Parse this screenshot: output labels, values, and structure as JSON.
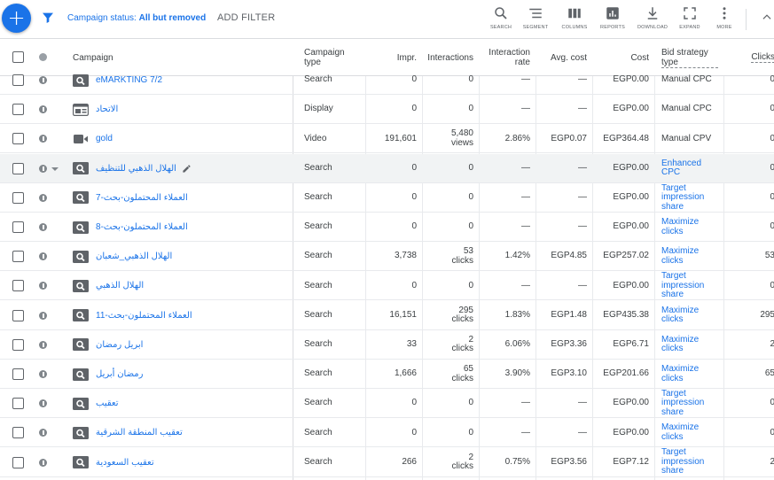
{
  "toolbar": {
    "new_button_label": "+",
    "filter_prefix": "Campaign status:",
    "filter_value": "All but removed",
    "add_filter_label": "ADD FILTER",
    "tools": [
      {
        "label": "SEARCH",
        "icon": "search-icon"
      },
      {
        "label": "SEGMENT",
        "icon": "segment-icon"
      },
      {
        "label": "COLUMNS",
        "icon": "columns-icon"
      },
      {
        "label": "REPORTS",
        "icon": "reports-icon"
      },
      {
        "label": "DOWNLOAD",
        "icon": "download-icon"
      },
      {
        "label": "EXPAND",
        "icon": "expand-icon"
      },
      {
        "label": "MORE",
        "icon": "more-vert-icon"
      }
    ],
    "collapse_icon": "chevron-up-icon"
  },
  "colors": {
    "accent": "#1a73e8",
    "text": "#3c4043",
    "border": "#dadce0"
  },
  "table": {
    "headers": {
      "campaign": "Campaign",
      "campaign_type": "Campaign type",
      "impr": "Impr.",
      "interactions": "Interactions",
      "interaction_rate": "Interaction rate",
      "avg_cost": "Avg. cost",
      "cost": "Cost",
      "bid_strategy": "Bid strategy type",
      "clicks": "Clicks"
    },
    "rows": [
      {
        "name": "eMARKTING 7/2",
        "type_icon": "search-campaign-icon",
        "type": "Search",
        "impr": "0",
        "interactions": "0",
        "interactions_unit": "",
        "rate": "—",
        "avg_cost": "—",
        "cost": "EGP0.00",
        "bid": "Manual CPC",
        "bid_link": false,
        "clicks": "0"
      },
      {
        "name": "الاتحاد",
        "type_icon": "display-campaign-icon",
        "type": "Display",
        "impr": "0",
        "interactions": "0",
        "interactions_unit": "",
        "rate": "—",
        "avg_cost": "—",
        "cost": "EGP0.00",
        "bid": "Manual CPC",
        "bid_link": false,
        "clicks": "0"
      },
      {
        "name": "gold",
        "type_icon": "video-campaign-icon",
        "type": "Video",
        "impr": "191,601",
        "interactions": "5,480",
        "interactions_unit": "views",
        "rate": "2.86%",
        "avg_cost": "EGP0.07",
        "cost": "EGP364.48",
        "bid": "Manual CPV",
        "bid_link": false,
        "clicks": "0"
      },
      {
        "name": "الهلال الذهبي للتنظيف",
        "type_icon": "search-campaign-icon",
        "type": "Search",
        "impr": "0",
        "interactions": "0",
        "interactions_unit": "",
        "rate": "—",
        "avg_cost": "—",
        "cost": "EGP0.00",
        "bid": "Enhanced CPC",
        "bid_link": true,
        "clicks": "0",
        "highlight": true
      },
      {
        "name": "العملاء المحتملون-بحث-7",
        "type_icon": "search-campaign-icon",
        "type": "Search",
        "impr": "0",
        "interactions": "0",
        "interactions_unit": "",
        "rate": "—",
        "avg_cost": "—",
        "cost": "EGP0.00",
        "bid": "Target impression share",
        "bid_link": true,
        "clicks": "0"
      },
      {
        "name": "العملاء المحتملون-بحث-8",
        "type_icon": "search-campaign-icon",
        "type": "Search",
        "impr": "0",
        "interactions": "0",
        "interactions_unit": "",
        "rate": "—",
        "avg_cost": "—",
        "cost": "EGP0.00",
        "bid": "Maximize clicks",
        "bid_link": true,
        "clicks": "0"
      },
      {
        "name": "الهلال الذهبي_شعبان",
        "type_icon": "search-campaign-icon",
        "type": "Search",
        "impr": "3,738",
        "interactions": "53",
        "interactions_unit": "clicks",
        "rate": "1.42%",
        "avg_cost": "EGP4.85",
        "cost": "EGP257.02",
        "bid": "Maximize clicks",
        "bid_link": true,
        "clicks": "53"
      },
      {
        "name": "الهلال الذهبي",
        "type_icon": "search-campaign-icon",
        "type": "Search",
        "impr": "0",
        "interactions": "0",
        "interactions_unit": "",
        "rate": "—",
        "avg_cost": "—",
        "cost": "EGP0.00",
        "bid": "Target impression share",
        "bid_link": true,
        "clicks": "0"
      },
      {
        "name": "العملاء المحتملون-بحث-11",
        "type_icon": "search-campaign-icon",
        "type": "Search",
        "impr": "16,151",
        "interactions": "295",
        "interactions_unit": "clicks",
        "rate": "1.83%",
        "avg_cost": "EGP1.48",
        "cost": "EGP435.38",
        "bid": "Maximize clicks",
        "bid_link": true,
        "clicks": "295"
      },
      {
        "name": "ابريل رمضان",
        "type_icon": "search-campaign-icon",
        "type": "Search",
        "impr": "33",
        "interactions": "2",
        "interactions_unit": "clicks",
        "rate": "6.06%",
        "avg_cost": "EGP3.36",
        "cost": "EGP6.71",
        "bid": "Maximize clicks",
        "bid_link": true,
        "clicks": "2"
      },
      {
        "name": "رمضان أبريل",
        "type_icon": "search-campaign-icon",
        "type": "Search",
        "impr": "1,666",
        "interactions": "65",
        "interactions_unit": "clicks",
        "rate": "3.90%",
        "avg_cost": "EGP3.10",
        "cost": "EGP201.66",
        "bid": "Maximize clicks",
        "bid_link": true,
        "clicks": "65"
      },
      {
        "name": "تعقيب",
        "type_icon": "search-campaign-icon",
        "type": "Search",
        "impr": "0",
        "interactions": "0",
        "interactions_unit": "",
        "rate": "—",
        "avg_cost": "—",
        "cost": "EGP0.00",
        "bid": "Target impression share",
        "bid_link": true,
        "clicks": "0"
      },
      {
        "name": "تعقيب المنطقة الشرقية",
        "type_icon": "search-campaign-icon",
        "type": "Search",
        "impr": "0",
        "interactions": "0",
        "interactions_unit": "",
        "rate": "—",
        "avg_cost": "—",
        "cost": "EGP0.00",
        "bid": "Maximize clicks",
        "bid_link": true,
        "clicks": "0"
      },
      {
        "name": "تعقيب السعودية",
        "type_icon": "search-campaign-icon",
        "type": "Search",
        "impr": "266",
        "interactions": "2",
        "interactions_unit": "clicks",
        "rate": "0.75%",
        "avg_cost": "EGP3.56",
        "cost": "EGP7.12",
        "bid": "Target impression share",
        "bid_link": true,
        "clicks": "2"
      }
    ]
  }
}
